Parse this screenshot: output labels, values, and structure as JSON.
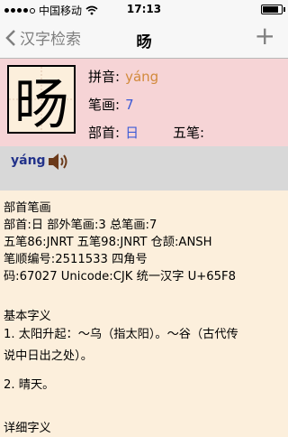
{
  "status": {
    "carrier": "中国移动",
    "time": "17:13",
    "battery_level": 0.85
  },
  "nav": {
    "back_label": "汉字检索",
    "title": "旸",
    "add_label": "+"
  },
  "entry": {
    "character": "旸",
    "pinyin_label": "拼音:",
    "pinyin_value": "yáng",
    "strokes_label": "笔画:",
    "strokes_value": "7",
    "radical_label": "部首:",
    "radical_value": "日",
    "wubi_label": "五笔:"
  },
  "audio": {
    "pinyin": "yáng",
    "icon": "speaker-icon"
  },
  "details": {
    "section_title": "部首笔画",
    "line1": "部首:日  部外笔画:3  总笔画:7",
    "line2": "五笔86:JNRT  五笔98:JNRT  仓颉:ANSH",
    "line3": "笔顺编号:2511533   四角号",
    "line4": "码:67027  Unicode:CJK 统一汉字 U+65F8",
    "basic_title": "基本字义",
    "basic_1a": "1. 太阳升起：～乌（指太阳）。～谷（古代传",
    "basic_1b": "说中日出之处）。",
    "basic_2": "2. 晴天。",
    "detail_title": "详细字义"
  }
}
